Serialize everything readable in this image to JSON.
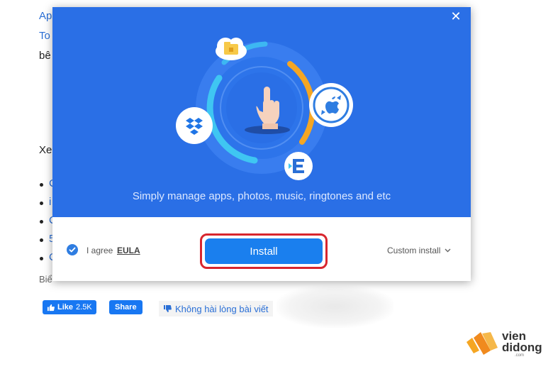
{
  "article": {
    "line1": "Ap",
    "line2": "To",
    "line3": "bê",
    "line4": "Xe",
    "bullets": [
      "C",
      "i",
      "C",
      "5",
      "C"
    ],
    "caption": "Biể",
    "like_label": "Like",
    "like_count": "2.5K",
    "share_label": "Share",
    "dislike_label": "Không hài lòng bài viết"
  },
  "dialog": {
    "close_glyph": "✕",
    "tagline": "Simply manage apps, photos, music, ringtones and etc",
    "agree_text": "I agree",
    "eula_link": "EULA",
    "install_label": "Install",
    "custom_install_label": "Custom install"
  },
  "logo": {
    "line1": "vien",
    "line2": "didong",
    "sub": ".com"
  },
  "colors": {
    "hero_blue": "#2a6fe6",
    "install_blue": "#1a7fee",
    "highlight_red": "#d8262e",
    "link_blue": "#2a6fd6"
  },
  "icons": [
    "folder-lock-icon",
    "dropbox-icon",
    "apple-sync-icon",
    "tap-hand-icon",
    "e-icon",
    "checkmark-icon",
    "chevron-down-icon",
    "thumbs-down-icon",
    "thumbs-up-icon"
  ]
}
